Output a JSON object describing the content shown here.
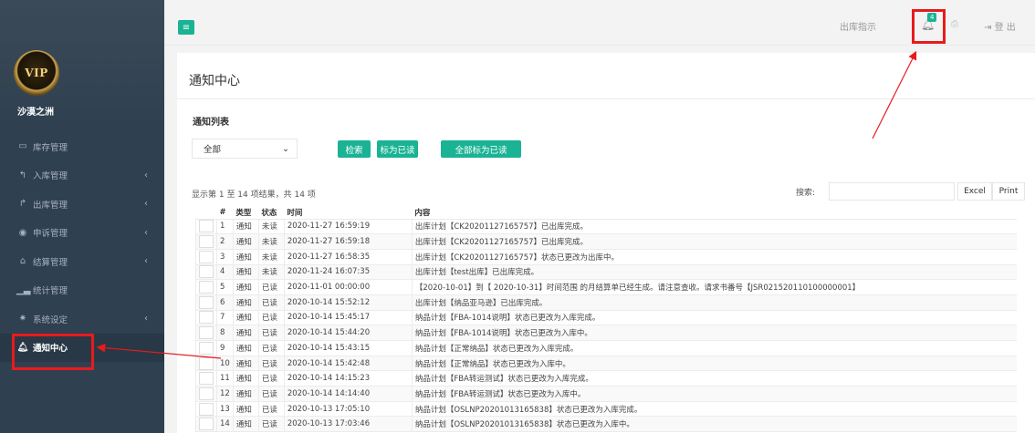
{
  "sidebar": {
    "logo_text": "VIP",
    "user_name": "沙漠之洲",
    "items": [
      {
        "label": "库存管理",
        "icon": "monitor-icon",
        "has_caret": false,
        "active": false
      },
      {
        "label": "入库管理",
        "icon": "reply-icon",
        "has_caret": true,
        "active": false
      },
      {
        "label": "出库管理",
        "icon": "share-icon",
        "has_caret": true,
        "active": false
      },
      {
        "label": "申诉管理",
        "icon": "eye-icon",
        "has_caret": true,
        "active": false
      },
      {
        "label": "结算管理",
        "icon": "bank-icon",
        "has_caret": true,
        "active": false
      },
      {
        "label": "统计管理",
        "icon": "chart-icon",
        "has_caret": false,
        "active": false
      },
      {
        "label": "系统设定",
        "icon": "gears-icon",
        "has_caret": true,
        "active": false
      },
      {
        "label": "通知中心",
        "icon": "bell-icon",
        "has_caret": false,
        "active": true
      }
    ]
  },
  "topbar": {
    "outbound_label": "出库指示",
    "notification_count": "4",
    "logout_label": "登 出"
  },
  "main": {
    "page_title": "通知中心",
    "section_title": "通知列表",
    "filter_value": "全部",
    "buttons": {
      "search": "检索",
      "mark_read": "标为已读",
      "mark_all_read": "全部标为已读"
    },
    "info_text": "显示第 1 至 14 项结果，共 14 项",
    "search_label": "搜索:",
    "excel_label": "Excel",
    "print_label": "Print",
    "table": {
      "headers": [
        "#",
        "类型",
        "状态",
        "时间",
        "内容"
      ],
      "rows": [
        [
          "1",
          "通知",
          "未读",
          "2020-11-27 16:59:19",
          "出库计划【CK20201127165757】已出库完成。"
        ],
        [
          "2",
          "通知",
          "未读",
          "2020-11-27 16:59:18",
          "出库计划【CK20201127165757】已出库完成。"
        ],
        [
          "3",
          "通知",
          "未读",
          "2020-11-27 16:58:35",
          "出库计划【CK20201127165757】状态已更改为出库中。"
        ],
        [
          "4",
          "通知",
          "未读",
          "2020-11-24 16:07:35",
          "出库计划【test出库】已出库完成。"
        ],
        [
          "5",
          "通知",
          "已读",
          "2020-11-01 00:00:00",
          "【2020-10-01】到【 2020-10-31】时间范围 的月结算单已经生成。请注意查收。请求书番号【JSR021520110100000001】"
        ],
        [
          "6",
          "通知",
          "已读",
          "2020-10-14 15:52:12",
          "出库计划【纳品亚马逊】已出库完成。"
        ],
        [
          "7",
          "通知",
          "已读",
          "2020-10-14 15:45:17",
          "纳品计划【FBA-1014说明】状态已更改为入库完成。"
        ],
        [
          "8",
          "通知",
          "已读",
          "2020-10-14 15:44:20",
          "纳品计划【FBA-1014说明】状态已更改为入库中。"
        ],
        [
          "9",
          "通知",
          "已读",
          "2020-10-14 15:43:15",
          "纳品计划【正常纳品】状态已更改为入库完成。"
        ],
        [
          "10",
          "通知",
          "已读",
          "2020-10-14 15:42:48",
          "纳品计划【正常纳品】状态已更改为入库中。"
        ],
        [
          "11",
          "通知",
          "已读",
          "2020-10-14 14:15:23",
          "纳品计划【FBA转运测试】状态已更改为入库完成。"
        ],
        [
          "12",
          "通知",
          "已读",
          "2020-10-14 14:14:40",
          "纳品计划【FBA转运测试】状态已更改为入库中。"
        ],
        [
          "13",
          "通知",
          "已读",
          "2020-10-13 17:05:10",
          "纳品计划【OSLNP20201013165838】状态已更改为入库完成。"
        ],
        [
          "14",
          "通知",
          "已读",
          "2020-10-13 17:03:46",
          "纳品计划【OSLNP20201013165838】状态已更改为入库中。"
        ]
      ]
    }
  },
  "colors": {
    "accent": "#1ab394",
    "sidebar": "#2f4050",
    "highlight": "#e81b1b"
  }
}
